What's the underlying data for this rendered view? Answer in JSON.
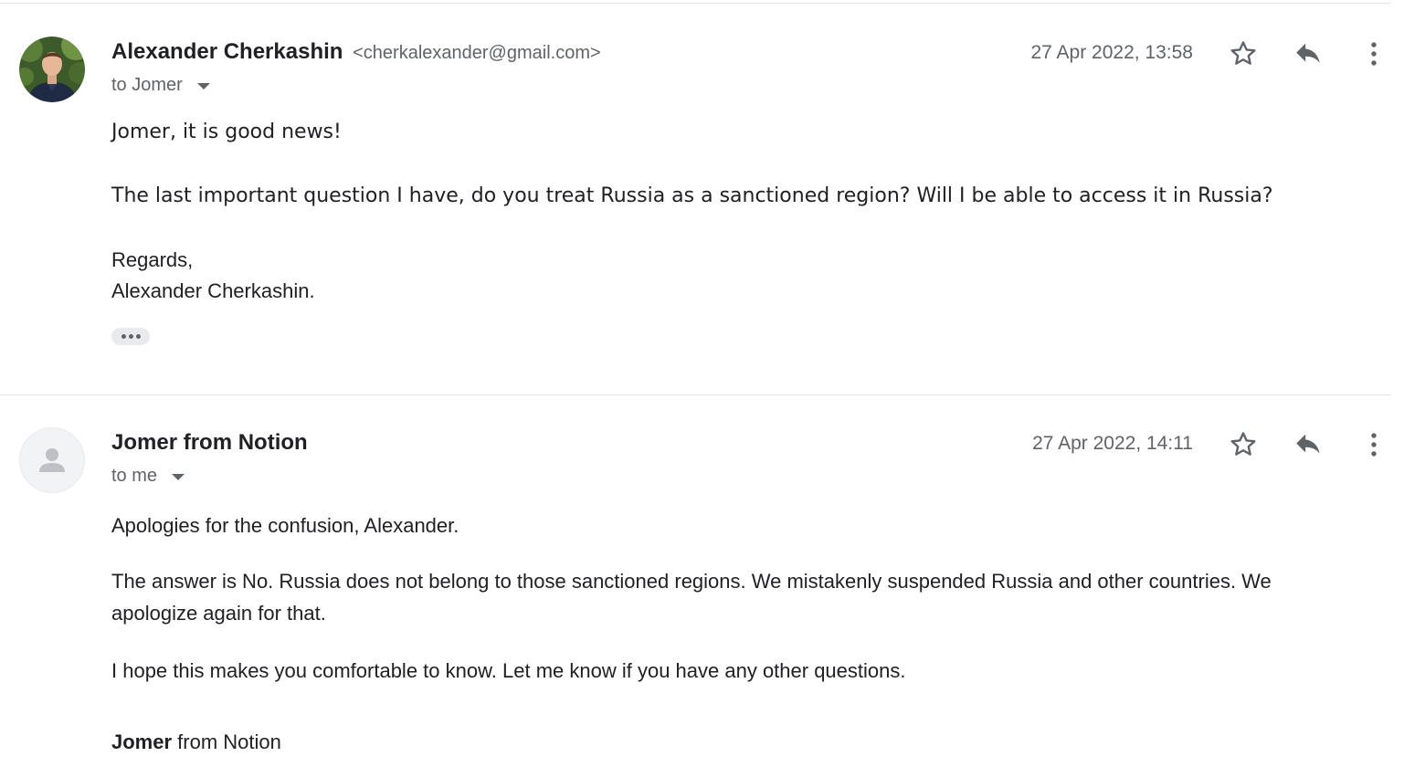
{
  "messages": [
    {
      "sender_name": "Alexander Cherkashin",
      "sender_email": "<cherkalexander@gmail.com>",
      "recipient": "to Jomer",
      "date": "27 Apr 2022, 13:58",
      "body": {
        "greeting": "Jomer, it is good news!",
        "question": "The last important question I have, do you treat Russia as a sanctioned region? Will I be able to access it in Russia?",
        "regards": "Regards,",
        "signature": "Alexander Cherkashin."
      }
    },
    {
      "sender_name": "Jomer from Notion",
      "recipient": "to me",
      "date": "27 Apr 2022, 14:11",
      "body": {
        "apology": "Apologies for the confusion, Alexander.",
        "answer": "The answer is No. Russia does not belong to those sanctioned regions. We mistakenly suspended Russia and other countries. We apologize again for that.",
        "hope": "I hope this makes you comfortable to know. Let me know if you have any other questions.",
        "signature_bold": "Jomer",
        "signature_rest": " from Notion"
      }
    }
  ],
  "icons": {
    "star": "star-outline-icon",
    "reply": "reply-icon",
    "more": "more-vertical-icon",
    "avatar_placeholder": "person-icon"
  },
  "colors": {
    "text_primary": "#202124",
    "text_secondary": "#5f6368",
    "divider": "#e3e3e3"
  }
}
